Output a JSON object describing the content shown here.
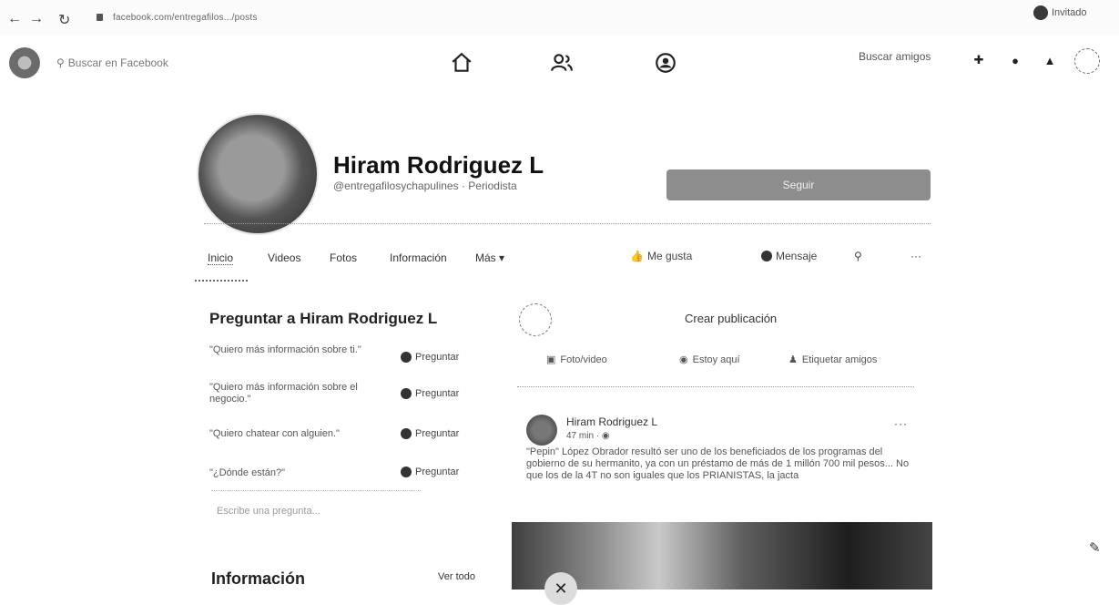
{
  "browser": {
    "url": "facebook.com/entregafilos.../posts",
    "profile_label": "Invitado"
  },
  "fb": {
    "search_placeholder": "Buscar en Facebook",
    "find_friends": "Buscar amigos"
  },
  "profile": {
    "name": "Hiram Rodriguez L",
    "handle": "@entregafilosychapulines · Periodista",
    "follow_label": "Seguir"
  },
  "tabs": [
    {
      "label": "Inicio"
    },
    {
      "label": "Videos"
    },
    {
      "label": "Fotos"
    },
    {
      "label": "Información"
    },
    {
      "label": "Más ▾"
    }
  ],
  "actions": {
    "like": "Me gusta",
    "message": "Mensaje"
  },
  "ask": {
    "title": "Preguntar a Hiram Rodriguez L",
    "questions": [
      "\"Quiero más información sobre ti.\"",
      "\"Quiero más información sobre el negocio.\"",
      "\"Quiero chatear con alguien.\"",
      "\"¿Dónde están?\""
    ],
    "button_label": "Preguntar",
    "custom_placeholder": "Escribe una pregunta..."
  },
  "info": {
    "title": "Información",
    "see_all": "Ver todo"
  },
  "composer": {
    "create_post": "Crear publicación",
    "photo_video": "Foto/video",
    "here": "Estoy aquí",
    "tag_friends": "Etiquetar amigos"
  },
  "post": {
    "author": "Hiram Rodriguez L",
    "time": "47 min · ◉",
    "text": "\"Pepin\" López Obrador resultó ser uno de los beneficiados de los programas del gobierno de su hermanito, ya con un préstamo de más de 1 millón 700 mil pesos... No que los de la 4T no son iguales que los PRIANISTAS, la jacta",
    "menu": "···"
  },
  "icons": {
    "back": "arrow-left-icon",
    "forward": "arrow-right-icon",
    "reload": "reload-icon",
    "home": "home-icon",
    "friends": "friends-icon",
    "groups": "groups-icon",
    "add": "plus-icon",
    "messenger": "messenger-icon",
    "notifications": "bell-icon",
    "edit": "edit-icon"
  }
}
